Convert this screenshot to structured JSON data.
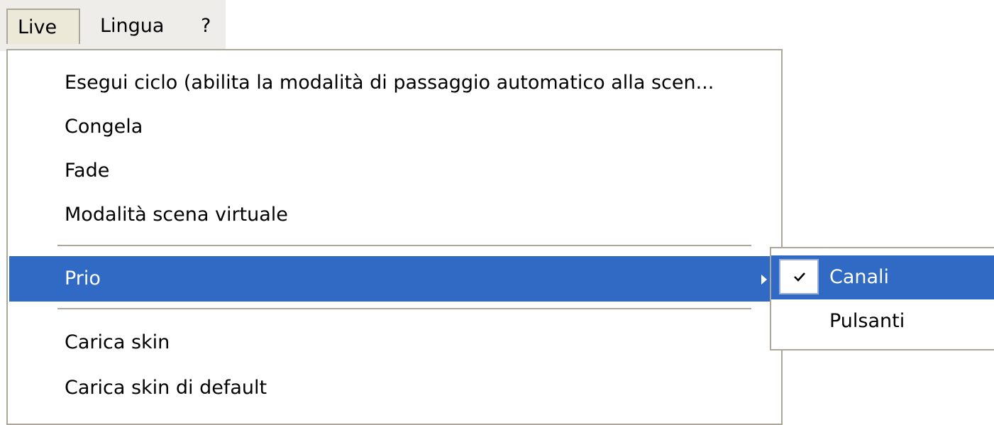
{
  "menubar": {
    "items": [
      {
        "label": "Live"
      },
      {
        "label": "Lingua"
      },
      {
        "label": "?"
      }
    ]
  },
  "live_menu": {
    "items": [
      {
        "label": "Esegui ciclo (abilita la modalità di passaggio automatico alla scen..."
      },
      {
        "label": "Congela"
      },
      {
        "label": "Fade"
      },
      {
        "label": "Modalità scena virtuale"
      },
      {
        "label": "Prio",
        "has_submenu": true,
        "highlighted": true
      },
      {
        "label": "Carica skin"
      },
      {
        "label": "Carica skin di default"
      }
    ]
  },
  "prio_submenu": {
    "items": [
      {
        "label": "Canali",
        "checked": true,
        "highlighted": true
      },
      {
        "label": "Pulsanti",
        "checked": false
      }
    ]
  },
  "colors": {
    "highlight": "#316ac5",
    "menu_border": "#aca899",
    "menubar_bg": "#eeede9"
  },
  "icons": {
    "submenu_arrow": "chevron-right-icon",
    "check": "check-icon"
  }
}
